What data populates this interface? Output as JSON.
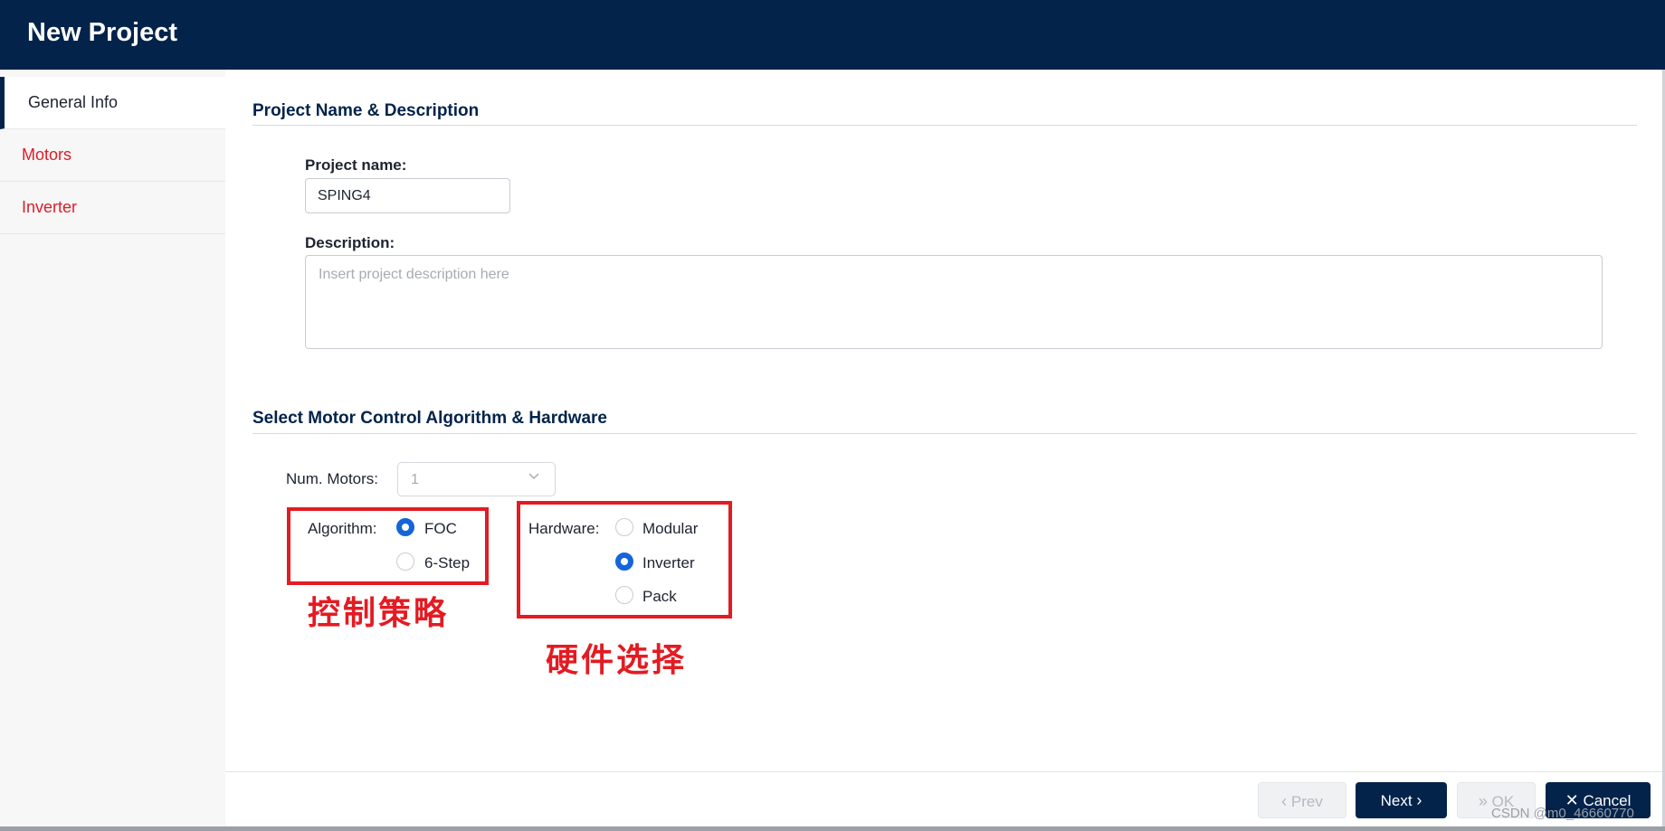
{
  "header": {
    "title": "New Project"
  },
  "sidebar": {
    "items": [
      {
        "label": "General Info",
        "active": true
      },
      {
        "label": "Motors",
        "active": false
      },
      {
        "label": "Inverter",
        "active": false
      }
    ]
  },
  "section1": {
    "title": "Project Name & Description",
    "project_name_label": "Project name:",
    "project_name_value": "SPING4",
    "description_label": "Description:",
    "description_placeholder": "Insert project description here"
  },
  "section2": {
    "title": "Select Motor Control Algorithm & Hardware",
    "num_motors_label": "Num. Motors:",
    "num_motors_value": "1",
    "algorithm_label": "Algorithm:",
    "algorithm_options": [
      {
        "label": "FOC",
        "checked": true
      },
      {
        "label": "6-Step",
        "checked": false
      }
    ],
    "hardware_label": "Hardware:",
    "hardware_options": [
      {
        "label": "Modular",
        "checked": false
      },
      {
        "label": "Inverter",
        "checked": true
      },
      {
        "label": "Pack",
        "checked": false
      }
    ]
  },
  "annotations": {
    "algorithm_note": "控制策略",
    "hardware_note": "硬件选择"
  },
  "footer": {
    "prev_label": "Prev",
    "next_label": "Next",
    "ok_label": "OK",
    "cancel_label": "Cancel"
  },
  "watermark": "CSDN @m0_46660770",
  "colors": {
    "header_bg": "#03234b",
    "accent_red": "#e31b23",
    "radio_blue": "#1565d8"
  }
}
